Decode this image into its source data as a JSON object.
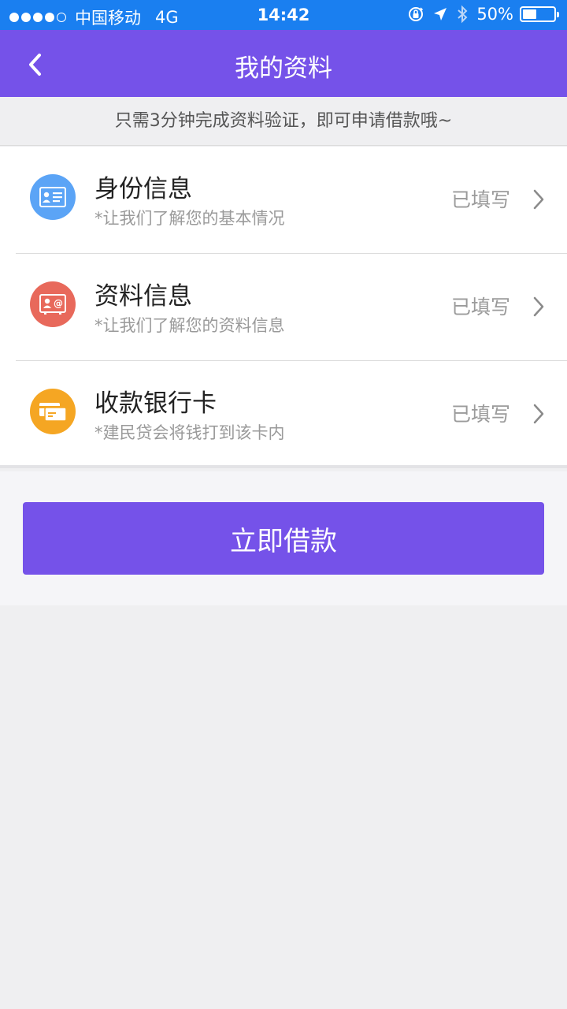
{
  "status_bar": {
    "carrier": "中国移动",
    "network": "4G",
    "time": "14:42",
    "battery": "50%",
    "battery_level": 0.5,
    "signal_bars_filled": 4,
    "signal_bars_total": 5,
    "icons": [
      "orientation-lock-icon",
      "location-arrow-icon",
      "bluetooth-icon",
      "battery-icon"
    ]
  },
  "nav": {
    "title": "我的资料",
    "back_icon": "chevron-left-icon"
  },
  "tip": "只需3分钟完成资料验证，即可申请借款哦~",
  "items": [
    {
      "title": "身份信息",
      "subtitle": "*让我们了解您的基本情况",
      "status": "已填写",
      "icon": "id-card-icon",
      "color": "#5ba4f6"
    },
    {
      "title": "资料信息",
      "subtitle": "*让我们了解您的资料信息",
      "status": "已填写",
      "icon": "contact-card-icon",
      "color": "#e8695b"
    },
    {
      "title": "收款银行卡",
      "subtitle": "*建民贷会将钱打到该卡内",
      "status": "已填写",
      "icon": "bank-card-icon",
      "color": "#f5a623"
    }
  ],
  "button": {
    "label": "立即借款"
  },
  "colors": {
    "primary": "#7552e9",
    "status_bar": "#1a7ff0",
    "background": "#efeff1"
  }
}
